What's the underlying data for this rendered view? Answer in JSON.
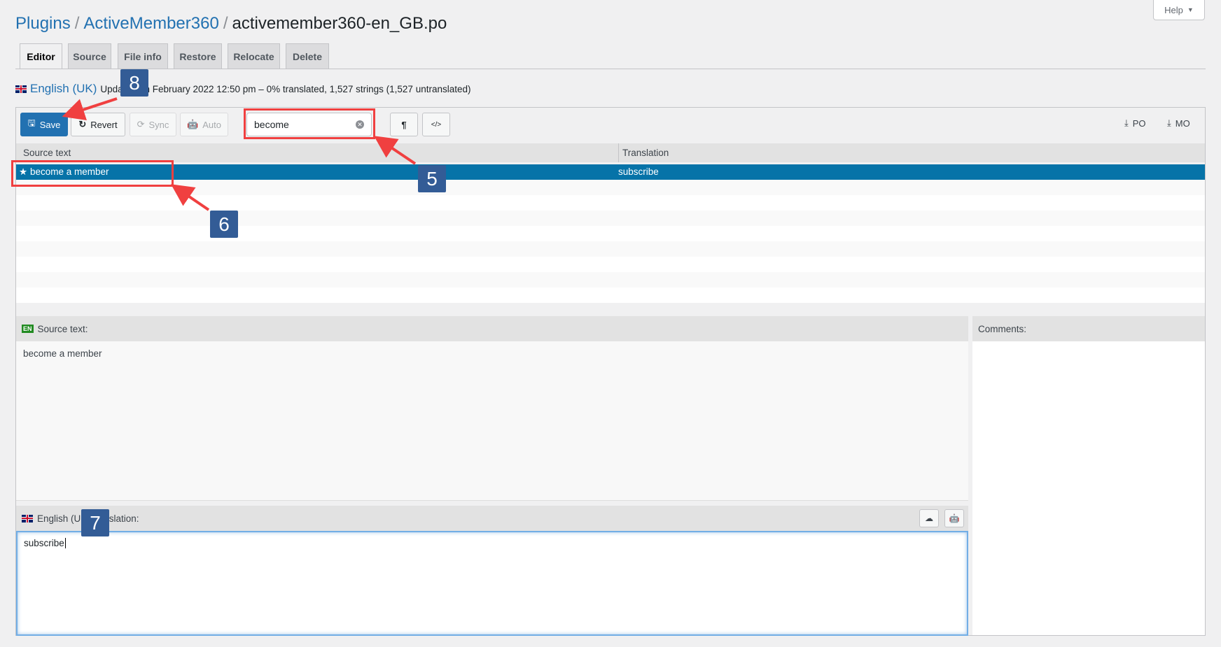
{
  "breadcrumb": {
    "items": [
      "Plugins",
      "ActiveMember360"
    ],
    "current": "activemember360-en_GB.po"
  },
  "help": {
    "label": "Help"
  },
  "tabs": [
    {
      "label": "Editor",
      "active": true
    },
    {
      "label": "Source"
    },
    {
      "label": "File info"
    },
    {
      "label": "Restore"
    },
    {
      "label": "Relocate"
    },
    {
      "label": "Delete"
    }
  ],
  "info": {
    "language": "English (UK)",
    "status_prefix": "Upda",
    "status_suffix": "th February 2022 12:50 pm – 0% translated, 1,527 strings (1,527 untranslated)"
  },
  "toolbar": {
    "save": "Save",
    "revert": "Revert",
    "sync": "Sync",
    "auto": "Auto",
    "search_value": "become",
    "pilcrow": "¶",
    "code": "</>",
    "po": "PO",
    "mo": "MO"
  },
  "list": {
    "col_source": "Source text",
    "col_translation": "Translation",
    "rows": [
      {
        "source": "become a member",
        "translation": "subscribe",
        "starred": true
      }
    ]
  },
  "source_panel": {
    "badge": "EN",
    "label": "Source text:",
    "text": "become a member"
  },
  "translation_panel": {
    "label": "English (UK) translation:",
    "text": "subscribe"
  },
  "comments_panel": {
    "label": "Comments:"
  },
  "annotations": [
    "8",
    "5",
    "6",
    "7"
  ],
  "colors": {
    "accent": "#2271b1",
    "selected_row": "#0673a8",
    "annotation_red": "#f04040",
    "annotation_badge": "#335c96"
  }
}
